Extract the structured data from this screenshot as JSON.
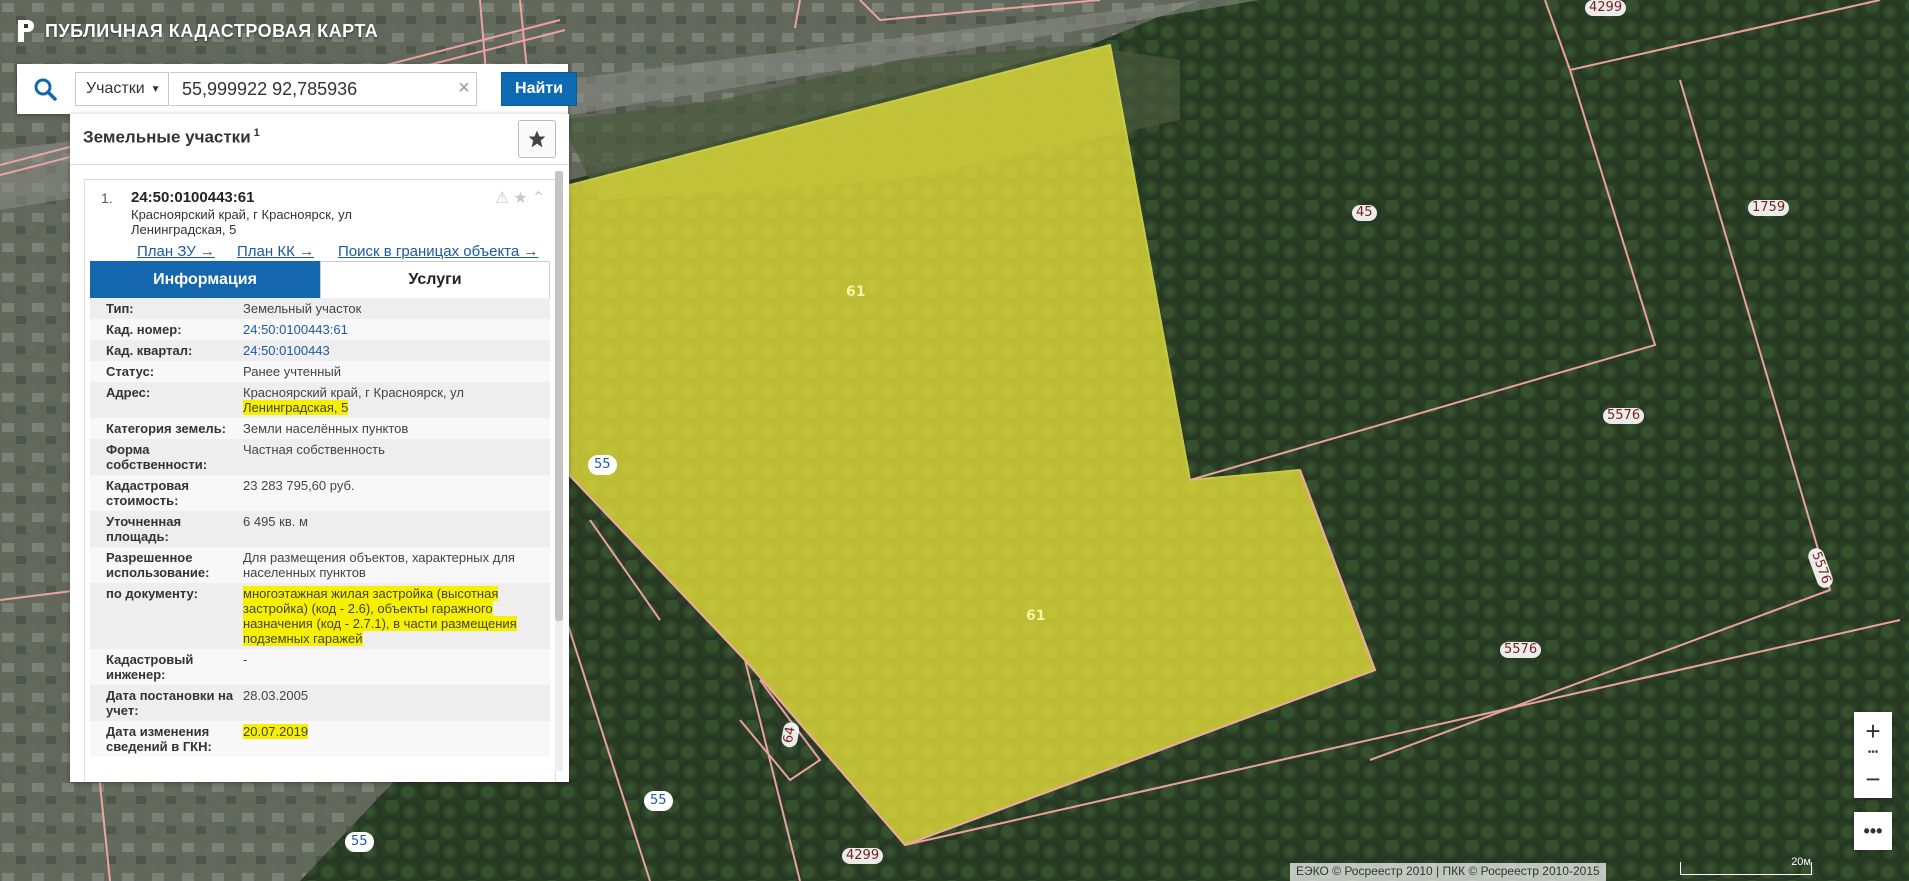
{
  "brand": {
    "title": "ПУБЛИЧНАЯ КАДАСТРОВАЯ КАРТА"
  },
  "search": {
    "type_selected": "Участки",
    "query": "55,999922 92,785936",
    "find_label": "Найти"
  },
  "panel": {
    "title": "Земельные участки",
    "count": "1",
    "result": {
      "number": "1.",
      "cadnum": "24:50:0100443:61",
      "address": "Красноярский край, г Красноярск, ул Ленинградская, 5",
      "links": [
        "План ЗУ →",
        "План КК →",
        "Поиск в границах объекта →"
      ]
    },
    "tabs": [
      "Информация",
      "Услуги"
    ],
    "rows": [
      {
        "k": "Тип:",
        "v": "Земельный участок"
      },
      {
        "k": "Кад. номер:",
        "v": "24:50:0100443:61"
      },
      {
        "k": "Кад. квартал:",
        "v": "24:50:0100443"
      },
      {
        "k": "Статус:",
        "v": "Ранее учтенный"
      },
      {
        "k": "Адрес:",
        "v": "Красноярский край, г Красноярск, ул",
        "v_hl": "Ленинградская, 5"
      },
      {
        "k": "Категория земель:",
        "v": "Земли населённых пунктов"
      },
      {
        "k": "Форма собственности:",
        "v": "Частная собственность"
      },
      {
        "k": "Кадастровая стоимость:",
        "v": "23 283 795,60 руб."
      },
      {
        "k": "Уточненная площадь:",
        "v": "6 495 кв. м"
      },
      {
        "k": "Разрешенное использование:",
        "v": "Для размещения объектов, характерных для населенных пунктов"
      },
      {
        "k": "по документу:",
        "v": "",
        "v_hl": "многоэтажная жилая застройка (высотная застройка) (код - 2.6), объекты гаражного назначения (код - 2.7.1), в части размещения подземных гаражей"
      },
      {
        "k": "Кадастровый инженер:",
        "v": "-"
      },
      {
        "k": "Дата постановки на учет:",
        "v": "28.03.2005"
      },
      {
        "k": "Дата изменения сведений в ГКН:",
        "v": "",
        "v_hl": "20.07.2019"
      }
    ]
  },
  "map": {
    "labels": [
      "45",
      "1759",
      "5576",
      "5576",
      "5576",
      "61",
      "61",
      "55",
      "55",
      "55",
      "4299",
      "4299",
      "64"
    ],
    "copyright": "ЕЭКО © Росреестр 2010 | ПКК © Росреестр 2010-2015",
    "scale": "20м"
  },
  "colors": {
    "accent": "#0d6ab3",
    "parcel": "#e6e23a",
    "highlight": "#f6f000"
  },
  "icons": [
    "search-icon",
    "clear-icon",
    "star-icon",
    "warning-icon",
    "chevron-up-icon",
    "zoom-in-icon",
    "zoom-out-icon",
    "more-icon"
  ]
}
